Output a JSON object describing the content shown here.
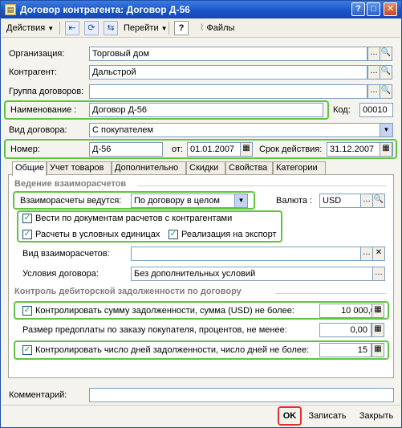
{
  "window": {
    "title": "Договор контрагента: Договор Д-56"
  },
  "toolbar": {
    "actions_label": "Действия",
    "goto_label": "Перейти",
    "help_label": "?",
    "files_label": "Файлы"
  },
  "form": {
    "org_label": "Организация:",
    "org_value": "Торговый дом",
    "contractor_label": "Контрагент:",
    "contractor_value": "Дальстрой",
    "group_label": "Группа договоров:",
    "group_value": "",
    "name_label": "Наименование :",
    "name_value": "Договор Д-56",
    "code_label": "Код:",
    "code_value": "00010",
    "type_label": "Вид договора:",
    "type_value": "С покупателем",
    "number_label": "Номер:",
    "number_value": "Д-56",
    "date_from_label": "от:",
    "date_from_value": "01.01.2007",
    "validity_label": "Срок действия:",
    "validity_value": "31.12.2007"
  },
  "tabs": [
    "Общие",
    "Учет товаров",
    "Дополнительно",
    "Скидки",
    "Свойства",
    "Категории"
  ],
  "general": {
    "section_settlements": "Ведение взаиморасчетов",
    "settlements_label": "Взаиморасчеты ведутся:",
    "settlements_value": "По договору в целом",
    "currency_label": "Валюта :",
    "currency_value": "USD",
    "cb_docs_label": "Вести по документам расчетов с контрагентами",
    "cb_units_label": "Расчеты в условных единицах",
    "cb_export_label": "Реализация на экспорт",
    "settlement_type_label": "Вид взаиморасчетов:",
    "settlement_type_value": "",
    "conditions_label": "Условия договора:",
    "conditions_value": "Без дополнительных условий",
    "section_debt": "Контроль дебиторской задолженности по договору",
    "cb_sum_label": "Контролировать сумму задолженности, сумма (USD) не более:",
    "sum_value": "10 000,00",
    "prepay_label": "Размер предоплаты по заказу покупателя, процентов, не менее:",
    "prepay_value": "0,00",
    "cb_days_label": "Контролировать число дней задолженности, число дней не более:",
    "days_value": "15"
  },
  "footer": {
    "comment_label": "Комментарий:",
    "comment_value": "",
    "ok_label": "OK",
    "save_label": "Записать",
    "close_label": "Закрыть"
  },
  "colors": {
    "titlebar": "#1a55c8",
    "highlight_green": "#5fc43f",
    "highlight_red": "#e03030",
    "checkbox_mark": "#21a121"
  }
}
